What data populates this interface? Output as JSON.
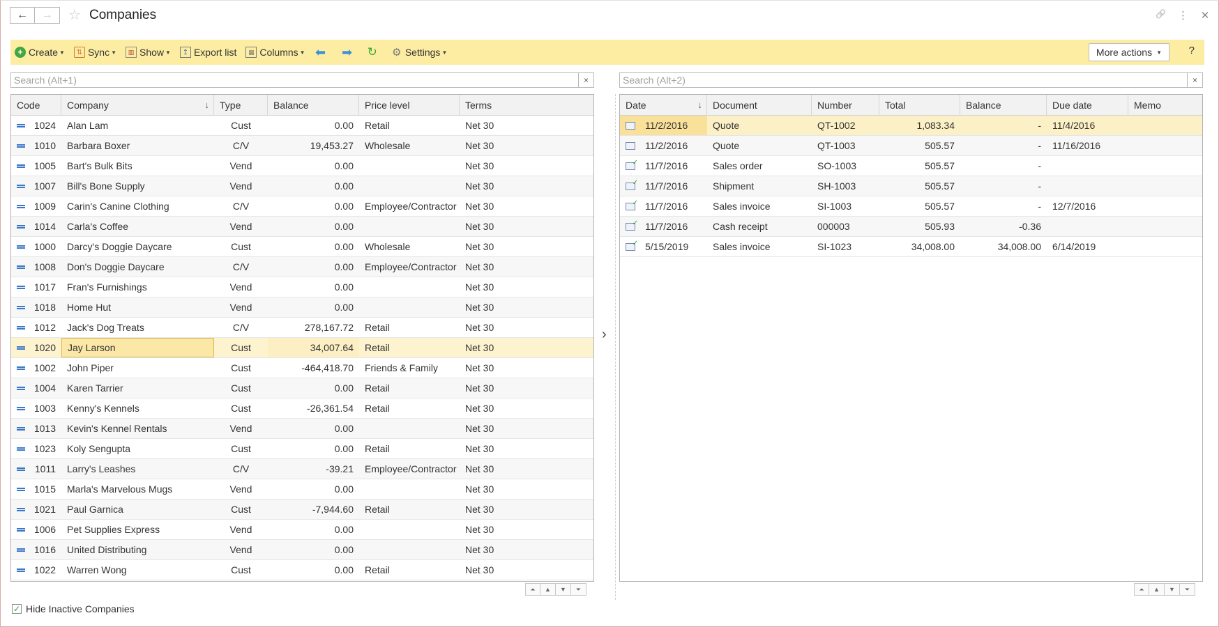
{
  "window": {
    "title": "Companies",
    "back_icon": "←",
    "forward_icon": "→",
    "star_icon": "☆",
    "link_icon": "🔗",
    "menu_icon": "⋮",
    "close_icon": "✕"
  },
  "toolbar": {
    "create_label": "Create",
    "sync_label": "Sync",
    "show_label": "Show",
    "export_label": "Export list",
    "columns_label": "Columns",
    "settings_label": "Settings",
    "more_actions_label": "More actions",
    "help_label": "?",
    "accent": "#fdeda3"
  },
  "left_search": {
    "placeholder": "Search (Alt+1)",
    "clear": "×"
  },
  "right_search": {
    "placeholder": "Search (Alt+2)",
    "clear": "×"
  },
  "companies": {
    "headers": [
      "Code",
      "Company",
      "Type",
      "Balance",
      "Price level",
      "Terms"
    ],
    "rows": [
      {
        "code": "1024",
        "company": "Alan Lam",
        "type": "Cust",
        "balance": "0.00",
        "price": "Retail",
        "terms": "Net 30"
      },
      {
        "code": "1010",
        "company": "Barbara Boxer",
        "type": "C/V",
        "balance": "19,453.27",
        "price": "Wholesale",
        "terms": "Net 30"
      },
      {
        "code": "1005",
        "company": "Bart's Bulk Bits",
        "type": "Vend",
        "balance": "0.00",
        "price": "",
        "terms": "Net 30"
      },
      {
        "code": "1007",
        "company": "Bill's Bone Supply",
        "type": "Vend",
        "balance": "0.00",
        "price": "",
        "terms": "Net 30"
      },
      {
        "code": "1009",
        "company": "Carin's Canine Clothing",
        "type": "C/V",
        "balance": "0.00",
        "price": "Employee/Contractor",
        "terms": "Net 30"
      },
      {
        "code": "1014",
        "company": "Carla's Coffee",
        "type": "Vend",
        "balance": "0.00",
        "price": "",
        "terms": "Net 30"
      },
      {
        "code": "1000",
        "company": "Darcy's Doggie Daycare",
        "type": "Cust",
        "balance": "0.00",
        "price": "Wholesale",
        "terms": "Net 30"
      },
      {
        "code": "1008",
        "company": "Don's Doggie Daycare",
        "type": "C/V",
        "balance": "0.00",
        "price": "Employee/Contractor",
        "terms": "Net 30"
      },
      {
        "code": "1017",
        "company": "Fran's Furnishings",
        "type": "Vend",
        "balance": "0.00",
        "price": "",
        "terms": "Net 30"
      },
      {
        "code": "1018",
        "company": "Home Hut",
        "type": "Vend",
        "balance": "0.00",
        "price": "",
        "terms": "Net 30"
      },
      {
        "code": "1012",
        "company": "Jack's Dog Treats",
        "type": "C/V",
        "balance": "278,167.72",
        "price": "Retail",
        "terms": "Net 30"
      },
      {
        "code": "1020",
        "company": "Jay Larson",
        "type": "Cust",
        "balance": "34,007.64",
        "price": "Retail",
        "terms": "Net 30"
      },
      {
        "code": "1002",
        "company": "John Piper",
        "type": "Cust",
        "balance": "-464,418.70",
        "price": "Friends & Family",
        "terms": "Net 30"
      },
      {
        "code": "1004",
        "company": "Karen Tarrier",
        "type": "Cust",
        "balance": "0.00",
        "price": "Retail",
        "terms": "Net 30"
      },
      {
        "code": "1003",
        "company": "Kenny's Kennels",
        "type": "Cust",
        "balance": "-26,361.54",
        "price": "Retail",
        "terms": "Net 30"
      },
      {
        "code": "1013",
        "company": "Kevin's Kennel Rentals",
        "type": "Vend",
        "balance": "0.00",
        "price": "",
        "terms": "Net 30"
      },
      {
        "code": "1023",
        "company": "Koly Sengupta",
        "type": "Cust",
        "balance": "0.00",
        "price": "Retail",
        "terms": "Net 30"
      },
      {
        "code": "1011",
        "company": "Larry's Leashes",
        "type": "C/V",
        "balance": "-39.21",
        "price": "Employee/Contractor",
        "terms": "Net 30"
      },
      {
        "code": "1015",
        "company": "Marla's Marvelous Mugs",
        "type": "Vend",
        "balance": "0.00",
        "price": "",
        "terms": "Net 30"
      },
      {
        "code": "1021",
        "company": "Paul Garnica",
        "type": "Cust",
        "balance": "-7,944.60",
        "price": "Retail",
        "terms": "Net 30"
      },
      {
        "code": "1006",
        "company": "Pet Supplies Express",
        "type": "Vend",
        "balance": "0.00",
        "price": "",
        "terms": "Net 30"
      },
      {
        "code": "1016",
        "company": "United Distributing",
        "type": "Vend",
        "balance": "0.00",
        "price": "",
        "terms": "Net 30"
      },
      {
        "code": "1022",
        "company": "Warren Wong",
        "type": "Cust",
        "balance": "0.00",
        "price": "Retail",
        "terms": "Net 30"
      }
    ]
  },
  "transactions": {
    "headers": [
      "Date",
      "Document",
      "Number",
      "Total",
      "Balance",
      "Due date",
      "Memo"
    ],
    "rows": [
      {
        "icon": "document-icon",
        "date": "11/2/2016",
        "document": "Quote",
        "number": "QT-1002",
        "total": "1,083.34",
        "balance": "-",
        "due": "11/4/2016",
        "memo": ""
      },
      {
        "icon": "document-icon",
        "date": "11/2/2016",
        "document": "Quote",
        "number": "QT-1003",
        "total": "505.57",
        "balance": "-",
        "due": "11/16/2016",
        "memo": ""
      },
      {
        "icon": "posted-document-icon",
        "date": "11/7/2016",
        "document": "Sales order",
        "number": "SO-1003",
        "total": "505.57",
        "balance": "-",
        "due": "",
        "memo": ""
      },
      {
        "icon": "posted-document-icon",
        "date": "11/7/2016",
        "document": "Shipment",
        "number": "SH-1003",
        "total": "505.57",
        "balance": "-",
        "due": "",
        "memo": ""
      },
      {
        "icon": "posted-document-icon",
        "date": "11/7/2016",
        "document": "Sales invoice",
        "number": "SI-1003",
        "total": "505.57",
        "balance": "-",
        "due": "12/7/2016",
        "memo": ""
      },
      {
        "icon": "posted-document-icon",
        "date": "11/7/2016",
        "document": "Cash receipt",
        "number": "000003",
        "total": "505.93",
        "balance": "-0.36",
        "due": "",
        "memo": ""
      },
      {
        "icon": "posted-document-icon",
        "date": "5/15/2019",
        "document": "Sales invoice",
        "number": "SI-1023",
        "total": "34,008.00",
        "balance": "34,008.00",
        "due": "6/14/2019",
        "memo": ""
      }
    ]
  },
  "footer": {
    "hide_inactive_label": "Hide Inactive Companies",
    "hide_inactive_checked": true
  }
}
